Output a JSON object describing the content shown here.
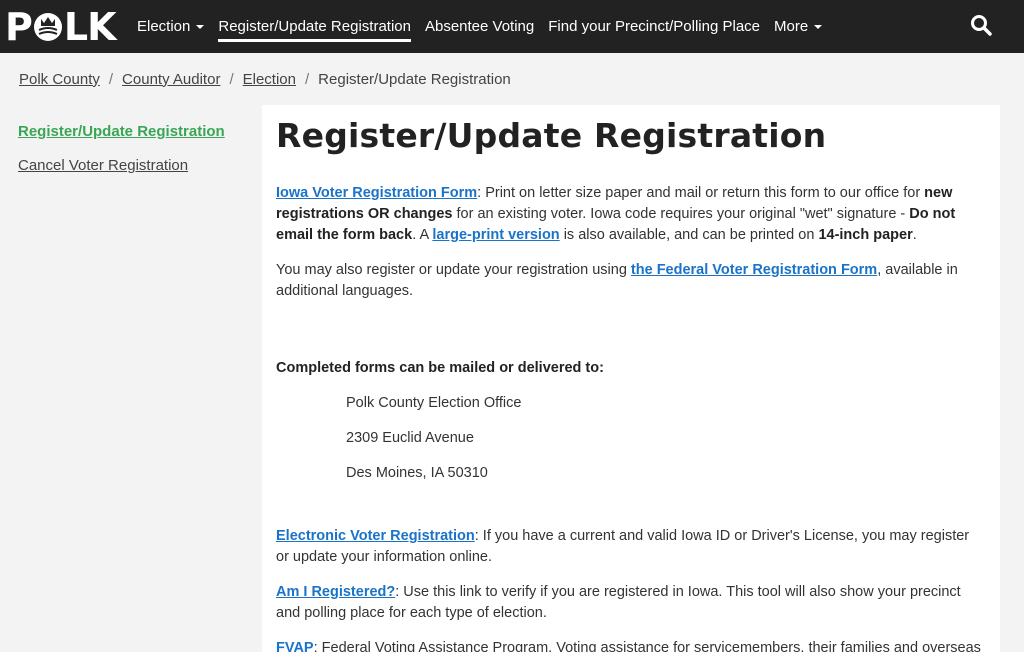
{
  "header": {
    "logo_text": "POLK",
    "nav": [
      {
        "label": "Election",
        "dropdown": true
      },
      {
        "label": "Register/Update Registration",
        "active": true
      },
      {
        "label": "Absentee Voting"
      },
      {
        "label": "Find your Precinct/Polling Place"
      },
      {
        "label": "More",
        "dropdown": true
      }
    ]
  },
  "breadcrumb": {
    "items": [
      "Polk County",
      "County Auditor",
      "Election"
    ],
    "current": "Register/Update Registration"
  },
  "sidenav": {
    "items": [
      "Register/Update Registration",
      "Cancel Voter Registration"
    ]
  },
  "content": {
    "title": "Register/Update Registration",
    "p1": {
      "link": "Iowa Voter Registration Form",
      "t1": ": Print on letter size paper and mail or return this form to our office for ",
      "b1": "new registrations OR changes",
      "t2": " for an existing voter. Iowa code requires your original \"wet\" signature - ",
      "b2": "Do not email the form back",
      "t3": ". A ",
      "link2": "large-print version",
      "t4": " is also available, and can be printed on ",
      "b3": "14-inch paper",
      "t5": "."
    },
    "p2": {
      "t1": "You may also register or update your registration using ",
      "link": "the Federal Voter Registration Form",
      "t2": ", available in additional languages."
    },
    "mail_heading": "Completed forms can be mailed or delivered to:",
    "address": [
      "Polk County Election Office",
      "2309 Euclid Avenue",
      "Des Moines, IA 50310"
    ],
    "p3": {
      "link": "Electronic Voter Registration",
      "t1": ": If you have a current and valid Iowa ID or Driver's License, you may register or update your information online."
    },
    "p4": {
      "link": "Am I Registered?",
      "t1": ": Use this link to verify if you are registered in Iowa. This tool will also show your precinct and polling place for each type of election."
    },
    "p5": {
      "link": "FVAP",
      "t1": ": Federal Voting Assistance Program. Voting assistance for servicemembers, their families and overseas citizens."
    }
  }
}
